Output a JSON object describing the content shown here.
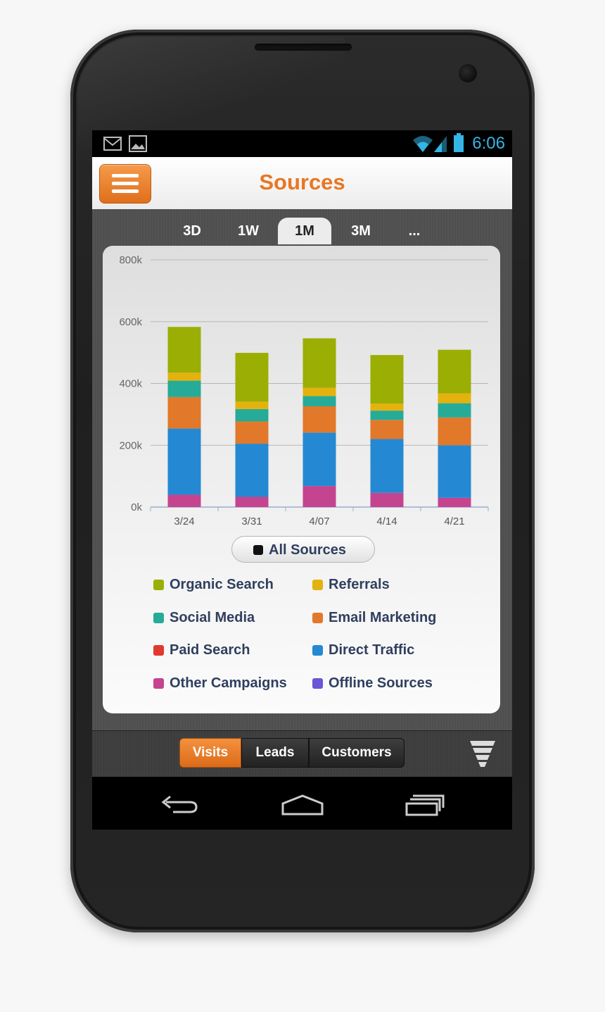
{
  "status_bar": {
    "time": "6:06",
    "icons": [
      "gmail-icon",
      "image-icon",
      "wifi-icon",
      "signal-icon",
      "battery-icon"
    ]
  },
  "header": {
    "title": "Sources",
    "menu_icon": "hamburger-icon"
  },
  "range_tabs": [
    {
      "label": "3D",
      "active": false
    },
    {
      "label": "1W",
      "active": false
    },
    {
      "label": "1M",
      "active": true
    },
    {
      "label": "3M",
      "active": false
    },
    {
      "label": "...",
      "active": false
    }
  ],
  "chart_data": {
    "type": "bar",
    "stacked": true,
    "categories": [
      "3/24",
      "3/31",
      "4/07",
      "4/14",
      "4/21"
    ],
    "ylim": [
      0,
      800000
    ],
    "yticks": [
      {
        "value": 0,
        "label": "0k"
      },
      {
        "value": 200000,
        "label": "200k"
      },
      {
        "value": 400000,
        "label": "400k"
      },
      {
        "value": 600000,
        "label": "600k"
      },
      {
        "value": 800000,
        "label": "800k"
      }
    ],
    "grid": true,
    "series": [
      {
        "name": "Other Campaigns",
        "color": "#c4448f",
        "values": [
          40000,
          33000,
          68000,
          46000,
          30000
        ]
      },
      {
        "name": "Direct Traffic",
        "color": "#2489d2",
        "values": [
          214000,
          172000,
          173000,
          174000,
          170000
        ]
      },
      {
        "name": "Email Marketing",
        "color": "#e2782a",
        "values": [
          102000,
          72000,
          85000,
          62000,
          90000
        ]
      },
      {
        "name": "Social Media",
        "color": "#25ab98",
        "values": [
          53000,
          40000,
          33000,
          30000,
          46000
        ]
      },
      {
        "name": "Referrals",
        "color": "#e4b20e",
        "values": [
          26000,
          24000,
          27000,
          23000,
          32000
        ]
      },
      {
        "name": "Organic Search",
        "color": "#9aae04",
        "values": [
          148000,
          158000,
          160000,
          157000,
          141000
        ]
      }
    ]
  },
  "filter": {
    "all_sources_label": "All Sources"
  },
  "legend": [
    {
      "label": "Organic Search",
      "color": "#9aae04"
    },
    {
      "label": "Referrals",
      "color": "#e4b20e"
    },
    {
      "label": "Social Media",
      "color": "#25ab98"
    },
    {
      "label": "Email Marketing",
      "color": "#e2782a"
    },
    {
      "label": "Paid Search",
      "color": "#e03a30"
    },
    {
      "label": "Direct Traffic",
      "color": "#2489d2"
    },
    {
      "label": "Other Campaigns",
      "color": "#c4448f"
    },
    {
      "label": "Offline Sources",
      "color": "#6a56d8"
    }
  ],
  "metric_tabs": [
    {
      "label": "Visits",
      "active": true
    },
    {
      "label": "Leads",
      "active": false
    },
    {
      "label": "Customers",
      "active": false
    }
  ],
  "funnel_icon": "funnel-icon",
  "nav": {
    "back_icon": "back-icon",
    "home_icon": "home-icon",
    "recents_icon": "recent-apps-icon"
  },
  "colors": {
    "accent": "#e87722",
    "status_blue": "#34b5e5",
    "legend_text": "#2f3f5e"
  }
}
